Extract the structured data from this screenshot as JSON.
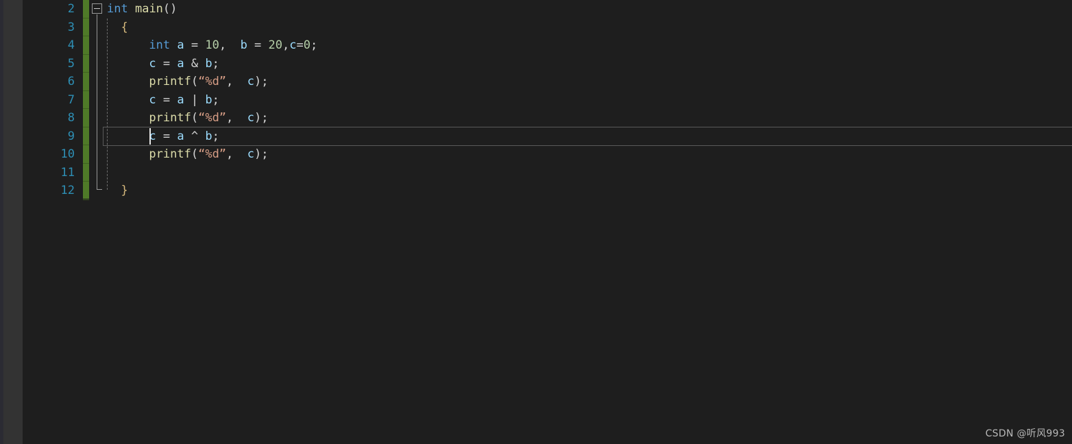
{
  "editor": {
    "theme_background": "#1e1e1e",
    "gutter_background": "#333333",
    "edge_strip_color": "#2b2b33",
    "linenumber_color": "#2e8fb5",
    "change_bar_color": "#4f7a28",
    "current_line_border_color": "#5a5a5a",
    "caret_color": "#e8e8e8",
    "first_visible_line": 2,
    "last_visible_line": 12,
    "cursor_line": 9,
    "cursor_column": 7,
    "line_height_px": 26.5
  },
  "gutter": {
    "line_numbers": [
      "2",
      "3",
      "4",
      "5",
      "6",
      "7",
      "8",
      "9",
      "10",
      "11",
      "12"
    ]
  },
  "fold": {
    "marker_symbol": "−",
    "marker_line": 2,
    "marker_state": "expanded"
  },
  "code": {
    "lines": [
      {
        "number": "2",
        "tokens": [
          {
            "text": "int",
            "kind": "keyword"
          },
          {
            "text": " ",
            "kind": "plain"
          },
          {
            "text": "main",
            "kind": "func"
          },
          {
            "text": "()",
            "kind": "punct"
          }
        ]
      },
      {
        "number": "3",
        "tokens": [
          {
            "text": "  ",
            "kind": "plain"
          },
          {
            "text": "{",
            "kind": "brace"
          }
        ]
      },
      {
        "number": "4",
        "tokens": [
          {
            "text": "      ",
            "kind": "plain"
          },
          {
            "text": "int",
            "kind": "keyword"
          },
          {
            "text": " ",
            "kind": "plain"
          },
          {
            "text": "a",
            "kind": "var"
          },
          {
            "text": " = ",
            "kind": "op"
          },
          {
            "text": "10",
            "kind": "num"
          },
          {
            "text": ",  ",
            "kind": "punct"
          },
          {
            "text": "b",
            "kind": "var"
          },
          {
            "text": " = ",
            "kind": "op"
          },
          {
            "text": "20",
            "kind": "num"
          },
          {
            "text": ",",
            "kind": "punct"
          },
          {
            "text": "c",
            "kind": "var"
          },
          {
            "text": "=",
            "kind": "op"
          },
          {
            "text": "0",
            "kind": "num"
          },
          {
            "text": ";",
            "kind": "punct"
          }
        ]
      },
      {
        "number": "5",
        "tokens": [
          {
            "text": "      ",
            "kind": "plain"
          },
          {
            "text": "c",
            "kind": "var"
          },
          {
            "text": " = ",
            "kind": "op"
          },
          {
            "text": "a",
            "kind": "var"
          },
          {
            "text": " & ",
            "kind": "op"
          },
          {
            "text": "b",
            "kind": "var"
          },
          {
            "text": ";",
            "kind": "punct"
          }
        ]
      },
      {
        "number": "6",
        "tokens": [
          {
            "text": "      ",
            "kind": "plain"
          },
          {
            "text": "printf",
            "kind": "func"
          },
          {
            "text": "(",
            "kind": "punct"
          },
          {
            "text": "“%d”",
            "kind": "string"
          },
          {
            "text": ",  ",
            "kind": "punct"
          },
          {
            "text": "c",
            "kind": "var"
          },
          {
            "text": ")",
            "kind": "punct"
          },
          {
            "text": ";",
            "kind": "punct"
          }
        ]
      },
      {
        "number": "7",
        "tokens": [
          {
            "text": "      ",
            "kind": "plain"
          },
          {
            "text": "c",
            "kind": "var"
          },
          {
            "text": " = ",
            "kind": "op"
          },
          {
            "text": "a",
            "kind": "var"
          },
          {
            "text": " | ",
            "kind": "op"
          },
          {
            "text": "b",
            "kind": "var"
          },
          {
            "text": ";",
            "kind": "punct"
          }
        ]
      },
      {
        "number": "8",
        "tokens": [
          {
            "text": "      ",
            "kind": "plain"
          },
          {
            "text": "printf",
            "kind": "func"
          },
          {
            "text": "(",
            "kind": "punct"
          },
          {
            "text": "“%d”",
            "kind": "string"
          },
          {
            "text": ",  ",
            "kind": "punct"
          },
          {
            "text": "c",
            "kind": "var"
          },
          {
            "text": ")",
            "kind": "punct"
          },
          {
            "text": ";",
            "kind": "punct"
          }
        ]
      },
      {
        "number": "9",
        "tokens": [
          {
            "text": "      ",
            "kind": "plain"
          },
          {
            "text": "c",
            "kind": "var"
          },
          {
            "text": " = ",
            "kind": "op"
          },
          {
            "text": "a",
            "kind": "var"
          },
          {
            "text": " ^ ",
            "kind": "op"
          },
          {
            "text": "b",
            "kind": "var"
          },
          {
            "text": ";",
            "kind": "punct"
          }
        ]
      },
      {
        "number": "10",
        "tokens": [
          {
            "text": "      ",
            "kind": "plain"
          },
          {
            "text": "printf",
            "kind": "func"
          },
          {
            "text": "(",
            "kind": "punct"
          },
          {
            "text": "“%d”",
            "kind": "string"
          },
          {
            "text": ",  ",
            "kind": "punct"
          },
          {
            "text": "c",
            "kind": "var"
          },
          {
            "text": ")",
            "kind": "punct"
          },
          {
            "text": ";",
            "kind": "punct"
          }
        ]
      },
      {
        "number": "11",
        "tokens": []
      },
      {
        "number": "12",
        "tokens": [
          {
            "text": "  ",
            "kind": "plain"
          },
          {
            "text": "}",
            "kind": "brace"
          }
        ]
      }
    ]
  },
  "watermark": {
    "text": "CSDN @听风993"
  }
}
